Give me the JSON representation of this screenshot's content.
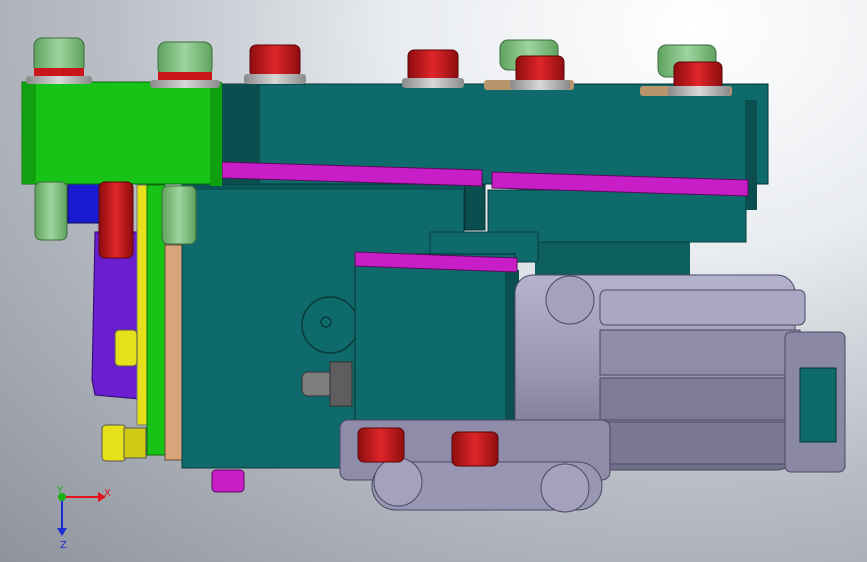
{
  "viewport": {
    "background_top": "#eef0f3",
    "background_bottom": "#8f949c"
  },
  "model": {
    "colors": {
      "teal": "#0f6b6b",
      "teal_dark": "#0a4e4f",
      "teal_light": "#178080",
      "green_plate": "#16c316",
      "magenta_strip": "#c81ec8",
      "purple": "#6a1ed0",
      "yellow": "#e6e01a",
      "tan": "#d9a47a",
      "light_green_pin": "#7fc07f",
      "red_pin": "#c8161a",
      "cylinder_body": "#9a98b4",
      "cylinder_dark": "#6f6d88",
      "blue_block": "#1a1ad0"
    }
  },
  "triad": {
    "x_label": "X",
    "y_label": "Y",
    "z_label": "Z",
    "x_color": "#e0141a",
    "y_color": "#17b017",
    "z_color": "#1d2bd6"
  }
}
